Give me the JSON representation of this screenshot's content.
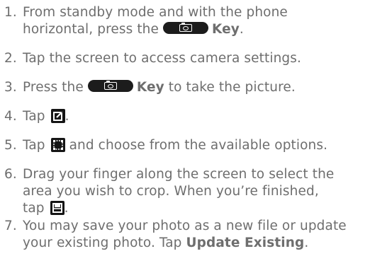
{
  "steps": [
    {
      "number": "1.",
      "line1": "From standby mode and with the phone",
      "line2_prefix": "horizontal, press the",
      "key_label": "Key",
      "end": "."
    },
    {
      "number": "2.",
      "text": "Tap the screen to access camera settings."
    },
    {
      "number": "3.",
      "prefix": "Press the",
      "key_label": "Key",
      "suffix": "to take the picture."
    },
    {
      "number": "4.",
      "prefix": "Tap",
      "suffix": "."
    },
    {
      "number": "5.",
      "prefix": "Tap",
      "suffix": "and choose from the available options."
    },
    {
      "number": "6.",
      "line1": "Drag your finger along the screen to select the",
      "line2": "area you wish to crop. When you’re finished,",
      "line3_prefix": "tap",
      "end": "."
    },
    {
      "number": "7.",
      "line1": "You may save your photo as a new file or update",
      "line2_prefix": "your existing photo. Tap",
      "bold_label": "Update Existing",
      "end": "."
    }
  ],
  "icons": {
    "camera_key": "camera-key-icon",
    "edit": "edit-icon",
    "crop": "crop-icon",
    "save": "save-icon"
  }
}
